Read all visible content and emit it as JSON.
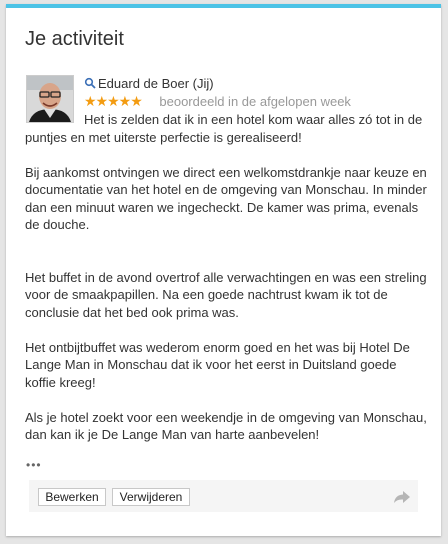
{
  "card": {
    "title": "Je activiteit"
  },
  "review": {
    "author": "Eduard de Boer (Jij)",
    "rating": 5,
    "rating_max": 5,
    "stars": "★★★★★",
    "when": "beoordeeld in de afgelopen week",
    "paragraphs": [
      "Het is zelden dat ik in een hotel kom waar alles zó tot in de puntjes en met uiterste perfectie is gerealiseerd!",
      "Bij aankomst ontvingen we direct een welkomstdrankje naar keuze en documentatie van het hotel en de omgeving van Monschau. In minder dan een minuut waren we ingecheckt. De kamer was prima, evenals de douche.",
      "Het buffet in de avond overtrof alle verwachtingen en was een streling voor de smaakpapillen. Na een goede nachtrust kwam ik tot de conclusie dat het bed ook prima was.",
      "Het ontbijtbuffet was wederom enorm goed en het was bij Hotel De Lange Man in Monschau dat ik voor het eerst in Duitsland goede koffie kreeg!",
      "Als je hotel zoekt voor een weekendje in de omgeving van Monschau, dan kan ik je De Lange Man van harte aanbevelen!"
    ],
    "more": "•••"
  },
  "actions": {
    "edit_label": "Bewerken",
    "remove_label": "Verwijderen"
  },
  "icons": {
    "search": "search-icon",
    "share": "share-arrow-icon"
  },
  "colors": {
    "accent": "#4cc3e6",
    "stars": "#f39c12"
  }
}
